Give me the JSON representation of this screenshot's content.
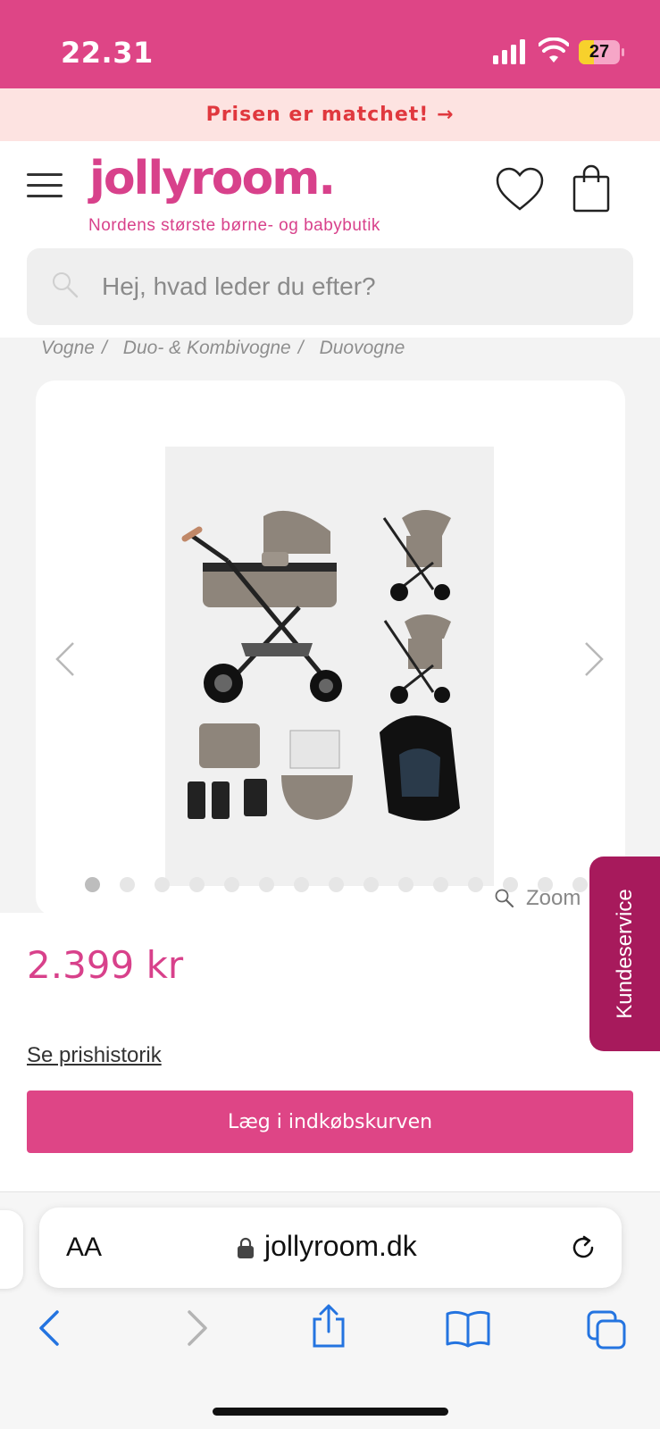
{
  "status_bar": {
    "time": "22.31",
    "battery": "27",
    "battery_color": "#f7d12c"
  },
  "promo": {
    "text": "Prisen er matchet! →"
  },
  "header": {
    "logo": "jollyroom.",
    "tagline": "Nordens største børne- og babybutik",
    "brand_color": "#d8418b",
    "icons": [
      "menu-icon",
      "heart-icon",
      "shopping-bag-icon"
    ]
  },
  "search": {
    "placeholder": "Hej, hvad leder du efter?"
  },
  "breadcrumb": {
    "items": [
      "Vogne",
      "Duo- & Kombivogne",
      "Duovogne"
    ]
  },
  "gallery": {
    "image_alt": "Duovogn med lift, autostol og tilbehør",
    "dot_count": 15,
    "active_dot": 0,
    "zoom_label": "Zoom"
  },
  "product": {
    "price": "2.399 kr",
    "price_history_link": "Se prishistorik",
    "add_to_cart": "Læg i indkøbskurven"
  },
  "side_tab": {
    "label": "Kundeservice"
  },
  "browser": {
    "aa_label": "AA",
    "url": "jollyroom.dk",
    "icons": [
      "back-icon",
      "forward-icon",
      "share-icon",
      "bookmarks-icon",
      "tabs-icon"
    ]
  }
}
